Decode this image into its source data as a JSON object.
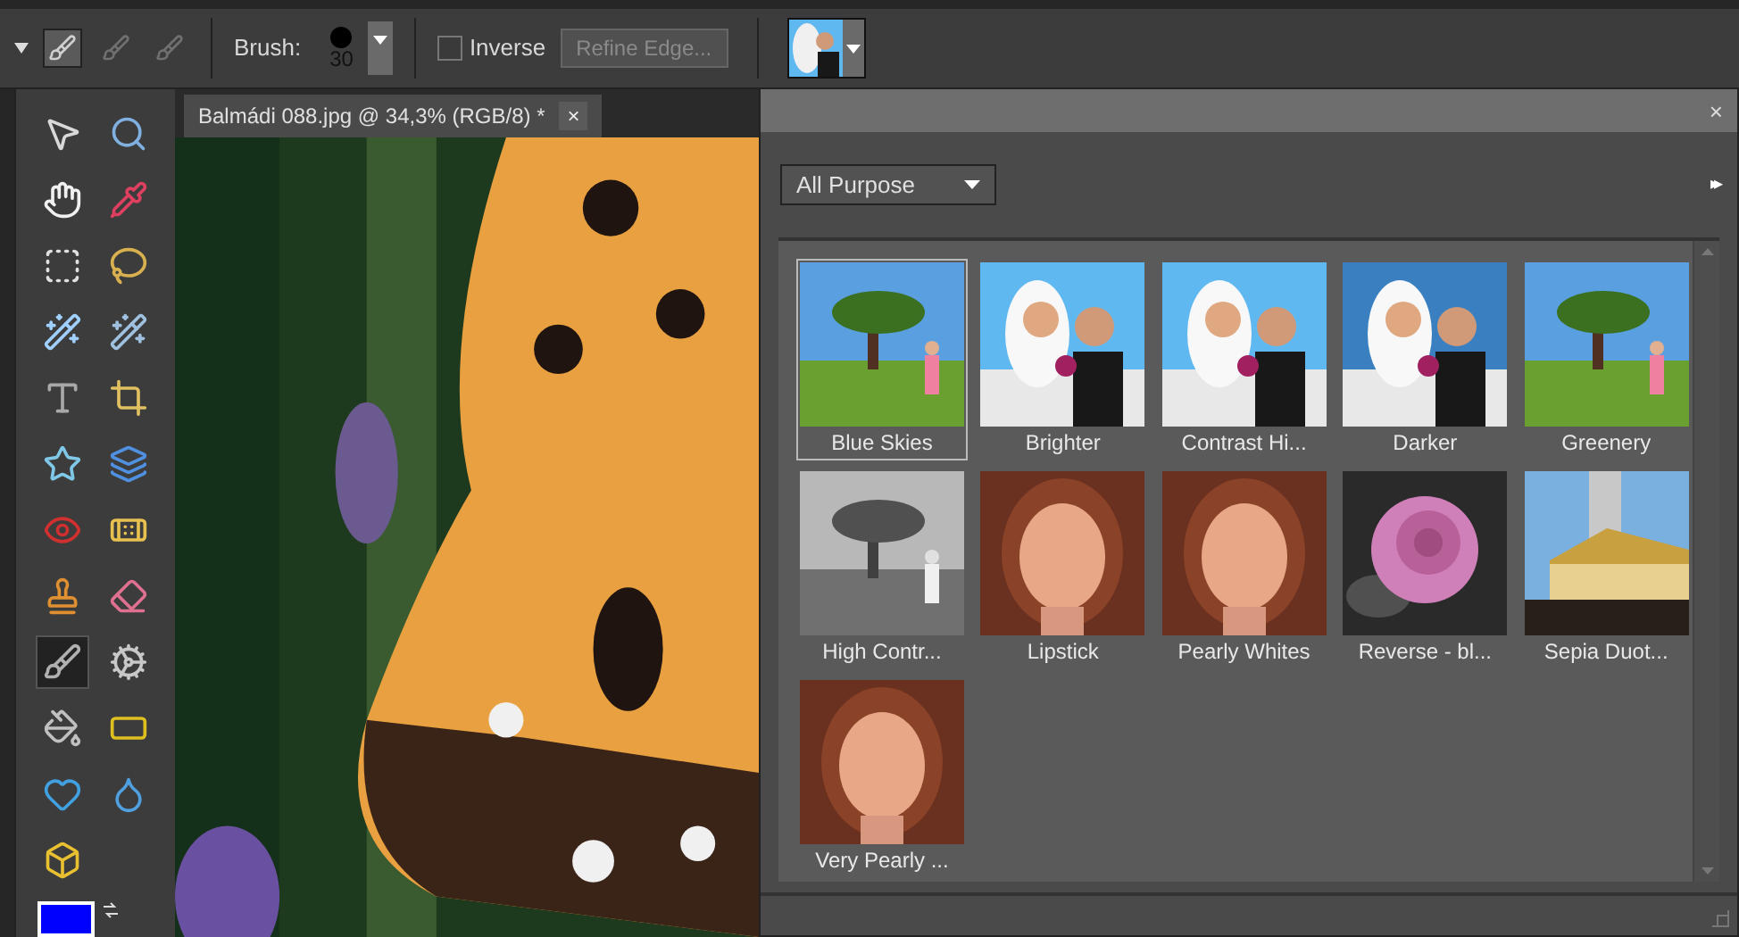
{
  "toolbar": {
    "brush_modes": [
      {
        "selected": true
      },
      {
        "selected": false
      },
      {
        "selected": false
      }
    ],
    "brush_label": "Brush:",
    "brush_size": "30",
    "inverse": {
      "label": "Inverse",
      "checked": false
    },
    "refine_edge": {
      "label": "Refine Edge...",
      "disabled": true
    }
  },
  "tools": [
    {
      "selected": false
    },
    {
      "selected": false
    },
    {
      "selected": false
    },
    {
      "selected": false
    },
    {
      "selected": false
    },
    {
      "selected": false
    },
    {
      "selected": false
    },
    {
      "selected": false
    },
    {
      "selected": false
    },
    {
      "selected": false
    },
    {
      "selected": false
    },
    {
      "selected": false
    },
    {
      "selected": false
    },
    {
      "selected": false
    },
    {
      "selected": false
    },
    {
      "selected": false
    },
    {
      "selected": true
    },
    {
      "selected": false
    },
    {
      "selected": false
    },
    {
      "selected": false
    },
    {
      "selected": false
    },
    {
      "selected": false
    },
    {
      "selected": false
    }
  ],
  "document_tab": {
    "title": "Balmádi 088.jpg @ 34,3% (RGB/8) *",
    "close": "×"
  },
  "panel": {
    "close": "×",
    "category": "All Purpose",
    "more": "▸▸",
    "presets": [
      {
        "label": "Blue Skies",
        "selected": true
      },
      {
        "label": "Brighter",
        "selected": false
      },
      {
        "label": "Contrast Hi...",
        "selected": false
      },
      {
        "label": "Darker",
        "selected": false
      },
      {
        "label": "Greenery",
        "selected": false
      },
      {
        "label": "High Contr...",
        "selected": false
      },
      {
        "label": "Lipstick",
        "selected": false
      },
      {
        "label": "Pearly Whites",
        "selected": false
      },
      {
        "label": "Reverse - bl...",
        "selected": false
      },
      {
        "label": "Sepia Duot...",
        "selected": false
      },
      {
        "label": "Very Pearly ...",
        "selected": false
      }
    ]
  }
}
